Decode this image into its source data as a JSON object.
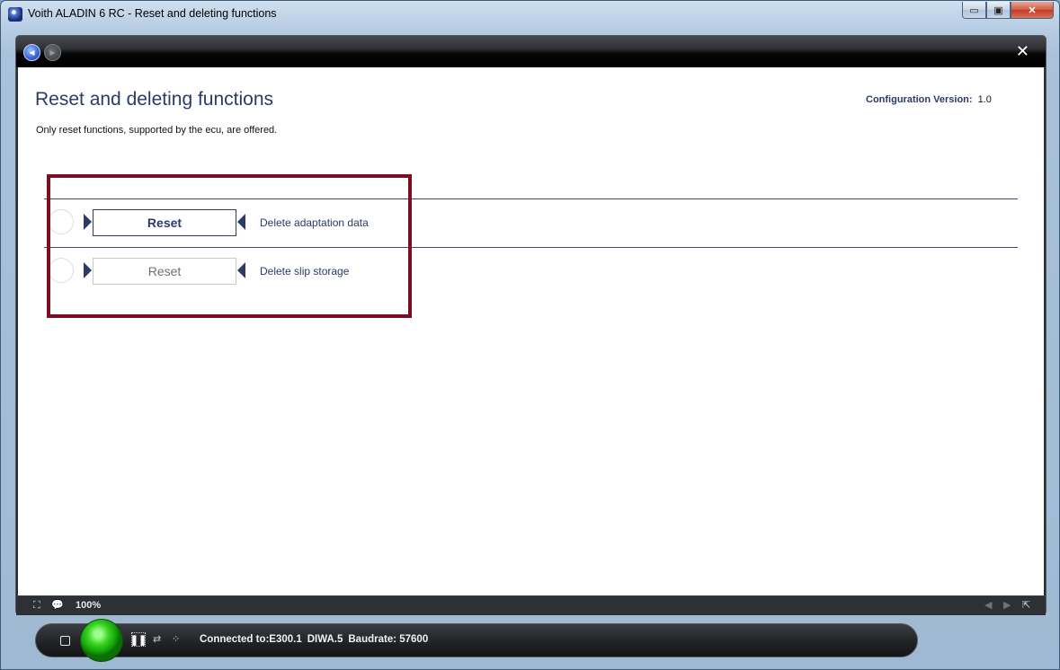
{
  "window": {
    "title": "Voith ALADIN 6 RC - Reset and deleting functions",
    "minimize_glyph": "▭",
    "maximize_glyph": "▣",
    "close_glyph": "✕"
  },
  "toolbar": {
    "back_glyph": "◀",
    "forward_glyph": "▶",
    "close_glyph": "✕"
  },
  "page": {
    "title": "Reset and deleting functions",
    "subtitle": "Only reset functions, supported by the ecu, are offered.",
    "config_label": "Configuration Version:",
    "config_value": "1.0"
  },
  "functions": [
    {
      "button_label": "Reset",
      "description": "Delete adaptation data",
      "enabled": true
    },
    {
      "button_label": "Reset",
      "description": "Delete slip storage",
      "enabled": false
    }
  ],
  "statusbar": {
    "fit_icon": "⛶",
    "comment_icon": "💬",
    "zoom": "100%",
    "prev_glyph": "◀",
    "next_glyph": "▶",
    "popout_glyph": "⇱"
  },
  "connection": {
    "pause_glyph": "❚❚",
    "config_glyph": "⇄",
    "grid_glyph": "⁘",
    "connected": "Connected to:E300.1",
    "device": "DIWA.5",
    "baudrate": "Baudrate: 57600",
    "status_color": "#2ec21a"
  },
  "colors": {
    "accent": "#2b3a67",
    "highlight_border": "#7d0e22"
  }
}
